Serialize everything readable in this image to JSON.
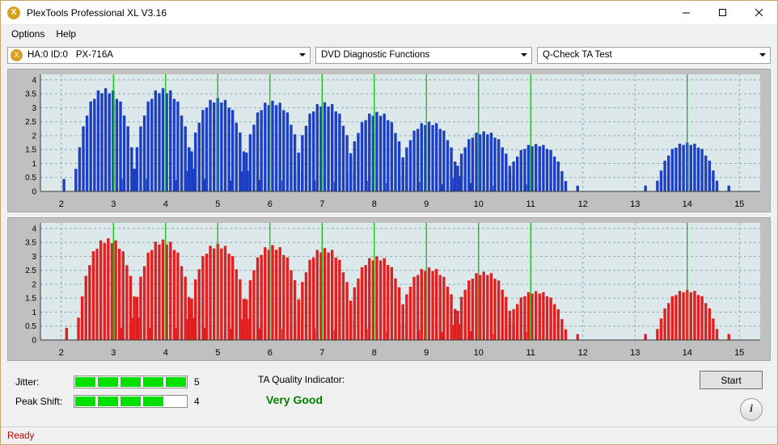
{
  "window": {
    "title": "PlexTools Professional XL V3.16",
    "app_icon": "plextools-icon",
    "minimize": "minimize-button",
    "maximize": "maximize-button",
    "close": "close-button"
  },
  "menubar": {
    "items": [
      {
        "label": "Options"
      },
      {
        "label": "Help"
      }
    ]
  },
  "toolbar": {
    "drive": "HA:0 ID:0",
    "drive_model": "PX-716A",
    "function": "DVD Diagnostic Functions",
    "test": "Q-Check TA Test"
  },
  "charts": [
    {
      "name": "ta-test-graph-blue",
      "color": "#1d3fc4",
      "marker_color": "#00c000",
      "background": "#dce8ea",
      "y_ticks": [
        "0",
        "0.5",
        "1",
        "1.5",
        "2",
        "2.5",
        "3",
        "3.5",
        "4"
      ],
      "x_ticks": [
        "2",
        "3",
        "4",
        "5",
        "6",
        "7",
        "8",
        "9",
        "10",
        "11",
        "12",
        "13",
        "14",
        "15"
      ],
      "ylim": [
        0,
        4.2
      ],
      "xlim": [
        1.6,
        15.4
      ],
      "markers": [
        3,
        4,
        5,
        6,
        7,
        8,
        9,
        10,
        11,
        14
      ],
      "groups": [
        {
          "center": 2.85,
          "peak": 3.7
        },
        {
          "center": 3.95,
          "peak": 3.7
        },
        {
          "center": 5.0,
          "peak": 3.35
        },
        {
          "center": 6.05,
          "peak": 3.25
        },
        {
          "center": 7.05,
          "peak": 3.2
        },
        {
          "center": 8.05,
          "peak": 2.85
        },
        {
          "center": 9.05,
          "peak": 2.5
        },
        {
          "center": 10.1,
          "peak": 2.15
        },
        {
          "center": 11.1,
          "peak": 1.7
        },
        {
          "center": 14.0,
          "peak": 1.75
        }
      ]
    },
    {
      "name": "ta-test-graph-red",
      "color": "#e02020",
      "marker_color": "#00c000",
      "background": "#dce8ea",
      "y_ticks": [
        "0",
        "0.5",
        "1",
        "1.5",
        "2",
        "2.5",
        "3",
        "3.5",
        "4"
      ],
      "x_ticks": [
        "2",
        "3",
        "4",
        "5",
        "6",
        "7",
        "8",
        "9",
        "10",
        "11",
        "12",
        "13",
        "14",
        "15"
      ],
      "ylim": [
        0,
        4.2
      ],
      "xlim": [
        1.6,
        15.4
      ],
      "markers": [
        3,
        4,
        5,
        6,
        7,
        8,
        9,
        10,
        11,
        14
      ],
      "groups": [
        {
          "center": 2.9,
          "peak": 3.65
        },
        {
          "center": 3.95,
          "peak": 3.6
        },
        {
          "center": 5.0,
          "peak": 3.45
        },
        {
          "center": 6.05,
          "peak": 3.4
        },
        {
          "center": 7.05,
          "peak": 3.3
        },
        {
          "center": 8.05,
          "peak": 3.0
        },
        {
          "center": 9.05,
          "peak": 2.6
        },
        {
          "center": 10.1,
          "peak": 2.45
        },
        {
          "center": 11.1,
          "peak": 1.75
        },
        {
          "center": 14.0,
          "peak": 1.8
        }
      ]
    }
  ],
  "meters": {
    "jitter": {
      "label": "Jitter:",
      "filled": 5,
      "total": 5,
      "value": "5"
    },
    "peak_shift": {
      "label": "Peak Shift:",
      "filled": 4,
      "total": 5,
      "value": "4"
    }
  },
  "quality": {
    "title": "TA Quality Indicator:",
    "value": "Very Good",
    "color": "#008000"
  },
  "actions": {
    "start": "Start",
    "info": "i"
  },
  "status": {
    "text": "Ready"
  }
}
